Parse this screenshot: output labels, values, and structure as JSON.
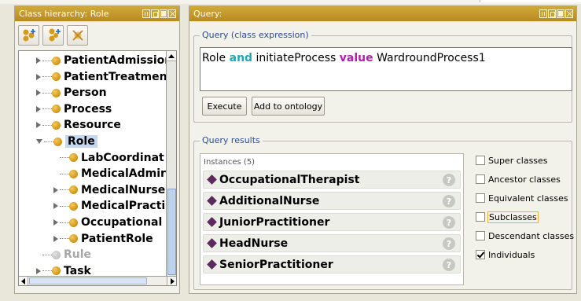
{
  "class_hierarchy": {
    "title": "Class hierarchy: Role",
    "tree": [
      {
        "label": "PatientAdmission",
        "expander": "collapsed",
        "muted": false,
        "selected": false,
        "indent": 0
      },
      {
        "label": "PatientTreatmen",
        "expander": "collapsed",
        "muted": false,
        "selected": false,
        "indent": 0
      },
      {
        "label": "Person",
        "expander": "collapsed",
        "muted": false,
        "selected": false,
        "indent": 0
      },
      {
        "label": "Process",
        "expander": "collapsed",
        "muted": false,
        "selected": false,
        "indent": 0
      },
      {
        "label": "Resource",
        "expander": "collapsed",
        "muted": false,
        "selected": false,
        "indent": 0
      },
      {
        "label": "Role",
        "expander": "expanded",
        "muted": false,
        "selected": true,
        "indent": 0
      },
      {
        "label": "LabCoordinat",
        "expander": "none",
        "muted": false,
        "selected": false,
        "indent": 1
      },
      {
        "label": "MedicalAdmir",
        "expander": "none",
        "muted": false,
        "selected": false,
        "indent": 1
      },
      {
        "label": "MedicalNurse",
        "expander": "collapsed",
        "muted": false,
        "selected": false,
        "indent": 1
      },
      {
        "label": "MedicalPracti",
        "expander": "collapsed",
        "muted": false,
        "selected": false,
        "indent": 1
      },
      {
        "label": "Occupational",
        "expander": "collapsed",
        "muted": false,
        "selected": false,
        "indent": 1
      },
      {
        "label": "PatientRole",
        "expander": "collapsed",
        "muted": false,
        "selected": false,
        "indent": 1
      },
      {
        "label": "Rule",
        "expander": "none",
        "muted": true,
        "selected": false,
        "indent": 0
      },
      {
        "label": "Task",
        "expander": "collapsed",
        "muted": false,
        "selected": false,
        "indent": 0
      }
    ]
  },
  "query": {
    "title": "Query:",
    "expression_legend": "Query (class expression)",
    "expression": {
      "part1": "Role ",
      "kw_and": "and",
      "part2": " initiateProcess ",
      "kw_value": "value",
      "part3": " WardroundProcess1"
    },
    "execute_label": "Execute",
    "add_label": "Add to ontology",
    "results_legend": "Query results",
    "instances_header": "Instances (5)",
    "results": [
      "OccupationalTherapist",
      "AdditionalNurse",
      "JuniorPractitioner",
      "HeadNurse",
      "SeniorPractitioner"
    ],
    "help_glyph": "?",
    "options": [
      {
        "label": "Super classes",
        "checked": false,
        "focused": false
      },
      {
        "label": "Ancestor classes",
        "checked": false,
        "focused": false
      },
      {
        "label": "Equivalent classes",
        "checked": false,
        "focused": false
      },
      {
        "label": "Subclasses",
        "checked": false,
        "focused": true
      },
      {
        "label": "Descendant classes",
        "checked": false,
        "focused": false
      },
      {
        "label": "Individuals",
        "checked": true,
        "focused": false
      }
    ]
  },
  "colors": {
    "titlebar": "#c39526",
    "legend_text": "#2a4c92",
    "keyword_and": "#1fa8b9",
    "keyword_value": "#b01fae",
    "class_bullet": "#d69b19",
    "individual_diamond": "#5c2a5e",
    "selection": "#c5d7ee"
  }
}
